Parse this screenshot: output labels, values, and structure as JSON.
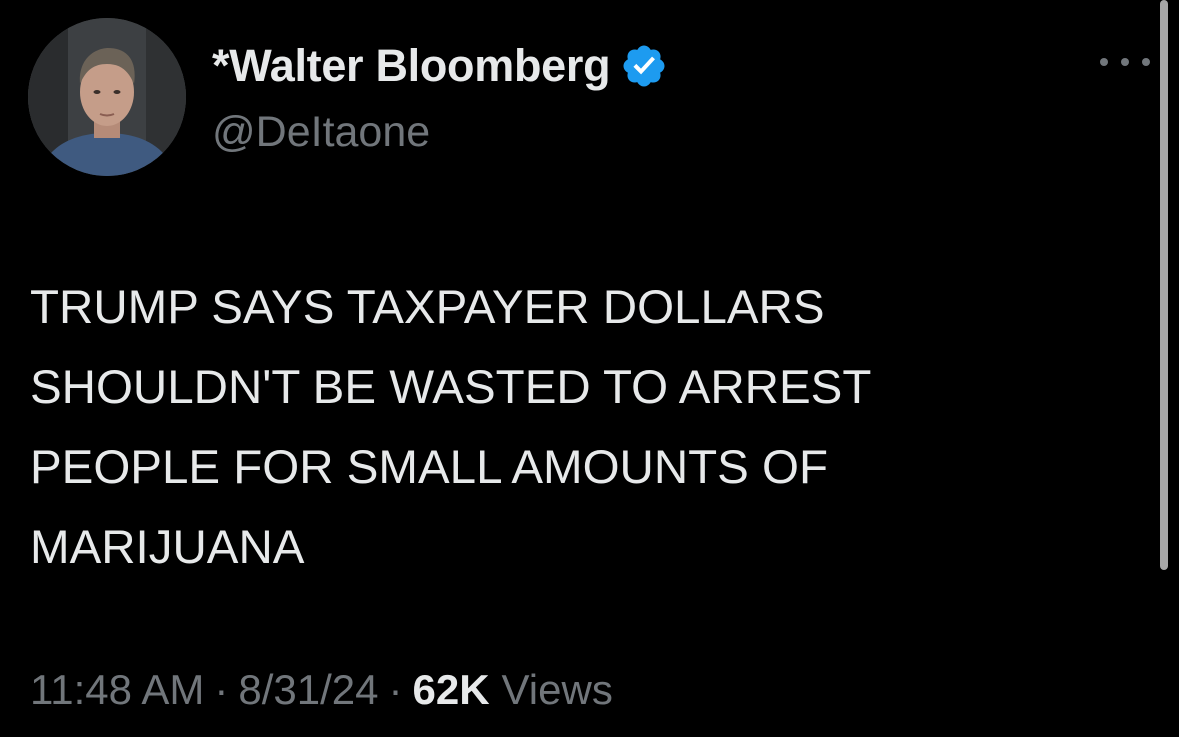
{
  "author": {
    "display_name": "*Walter Bloomberg",
    "handle": "@DeItaone",
    "verified": true,
    "verified_color": "#1d9bf0",
    "avatar_icon": "avatar-photo"
  },
  "tweet": {
    "text": "TRUMP SAYS TAXPAYER DOLLARS\nSHOULDN'T BE WASTED TO ARREST\nPEOPLE FOR SMALL AMOUNTS OF\nMARIJUANA"
  },
  "meta": {
    "time": "11:48 AM",
    "separator": "·",
    "date": "8/31/24",
    "views_count": "62K",
    "views_label": "Views"
  },
  "actions": {
    "more_icon": "more-horizontal-icon"
  },
  "colors": {
    "background": "#000000",
    "primary_text": "#e7e9ea",
    "secondary_text": "#71767b",
    "accent": "#1d9bf0"
  }
}
